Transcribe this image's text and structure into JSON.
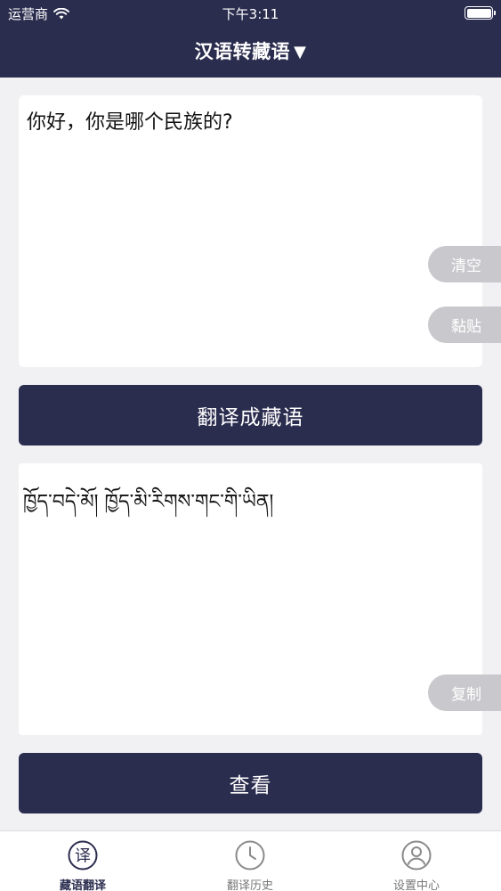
{
  "status_bar": {
    "carrier": "运营商",
    "time": "下午3:11",
    "battery_level": 1.0
  },
  "header": {
    "title": "汉语转藏语",
    "caret": "▼"
  },
  "input": {
    "text": "你好，你是哪个民族的?"
  },
  "side_actions": {
    "clear": "清空",
    "paste": "黏贴",
    "copy": "复制"
  },
  "buttons": {
    "translate": "翻译成藏语",
    "view": "查看"
  },
  "output": {
    "text": "ཁྱོད་བདེ་མོ། ཁྱོད་མི་རིགས་གང་གི་ཡིན།"
  },
  "tabs": [
    {
      "label": "藏语翻译",
      "icon": "translate-icon",
      "active": true
    },
    {
      "label": "翻译历史",
      "icon": "clock-icon",
      "active": false
    },
    {
      "label": "设置中心",
      "icon": "user-icon",
      "active": false
    }
  ],
  "colors": {
    "primary": "#2b2d4f",
    "pill": "#c9c9cd",
    "background": "#f1f1f3"
  }
}
